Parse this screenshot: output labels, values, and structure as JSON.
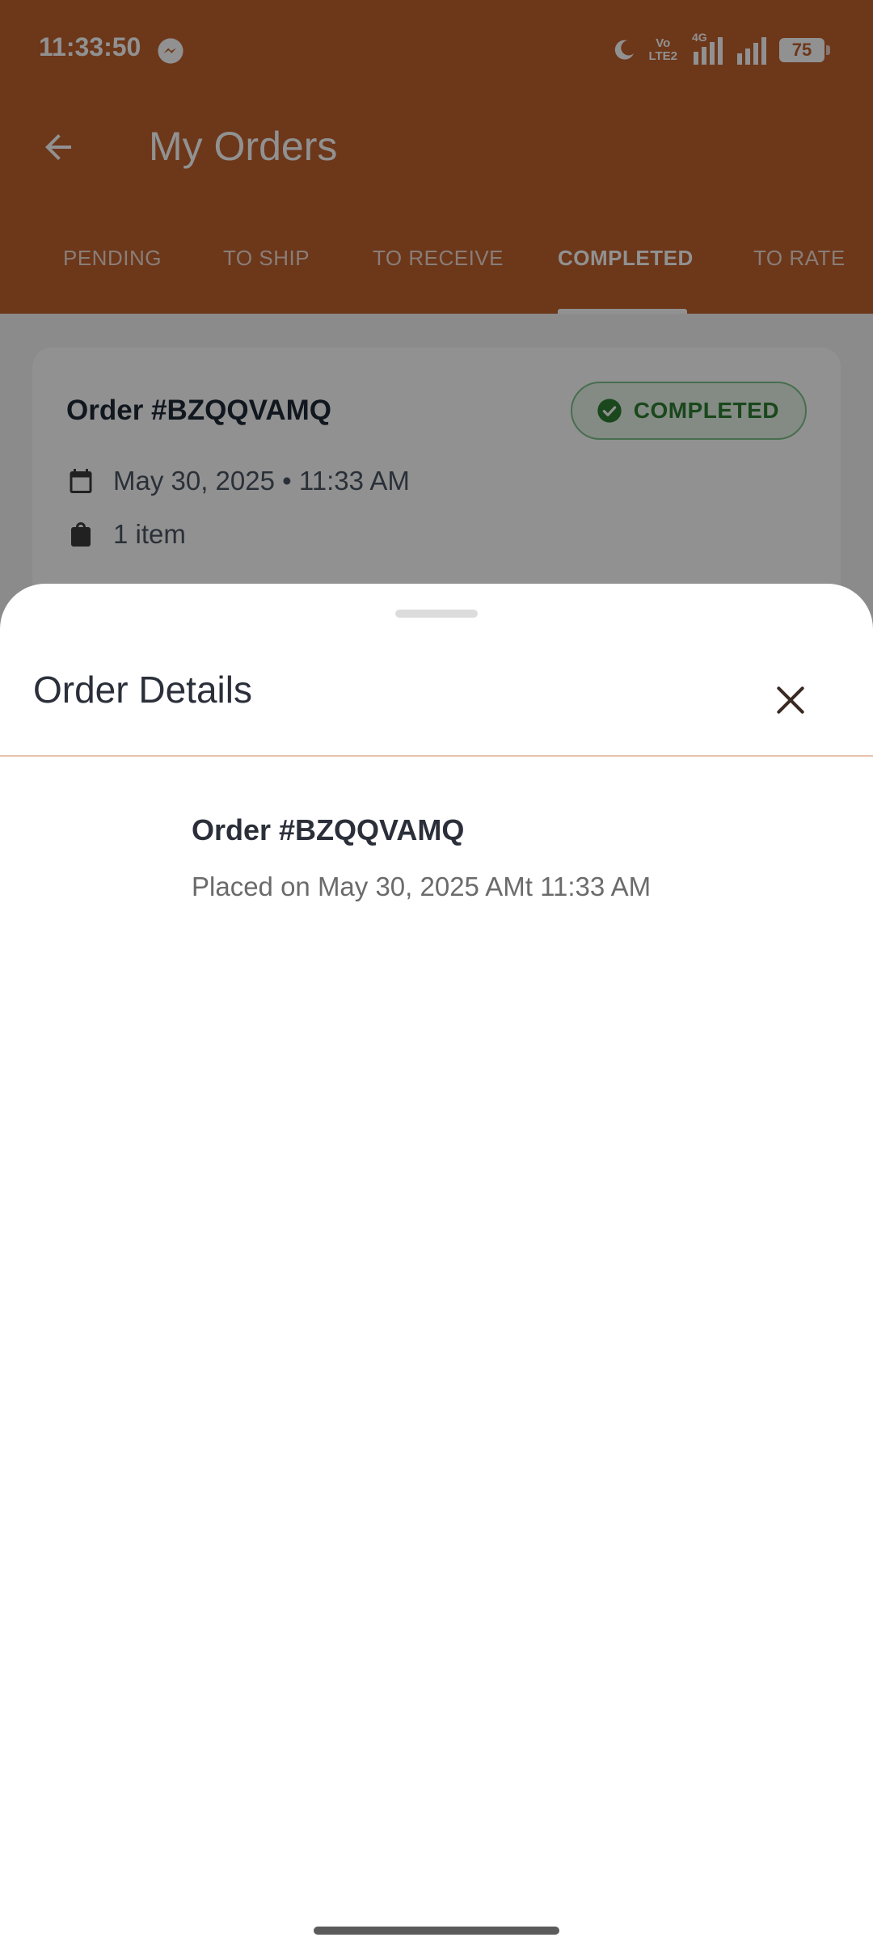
{
  "status_bar": {
    "time": "11:33:50",
    "volte_line1": "Vo",
    "volte_line2": "LTE2",
    "network": "4G",
    "battery": "75"
  },
  "header": {
    "title": "My Orders",
    "tabs": [
      {
        "label": "PENDING"
      },
      {
        "label": "TO SHIP"
      },
      {
        "label": "TO RECEIVE"
      },
      {
        "label": "COMPLETED"
      },
      {
        "label": "TO RATE"
      }
    ],
    "active_tab": "COMPLETED"
  },
  "order_card": {
    "title": "Order #BZQQVAMQ",
    "status": "COMPLETED",
    "date": "May 30, 2025 • 11:33 AM",
    "items": "1 item"
  },
  "sheet": {
    "title": "Order Details",
    "order_number": "Order #BZQQVAMQ",
    "placed_text": "Placed on May 30, 2025 AMt 11:33 AM"
  },
  "colors": {
    "brand": "#c0622e",
    "status_green": "#2e7d32",
    "divider": "#e6c2ad"
  }
}
